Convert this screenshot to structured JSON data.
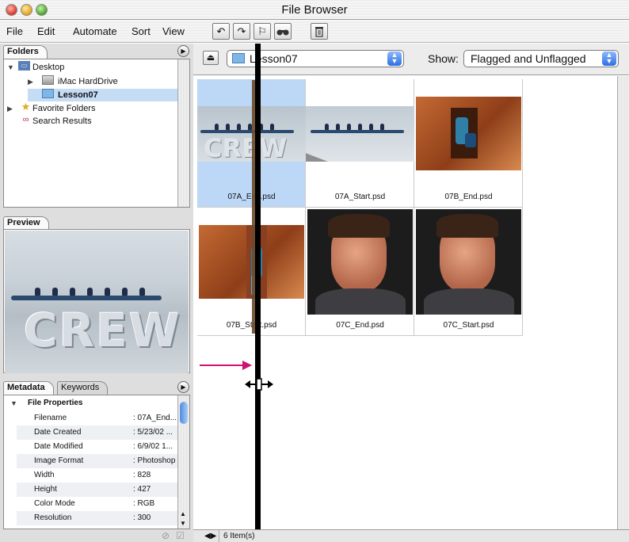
{
  "window": {
    "title": "File Browser"
  },
  "menu": {
    "items": [
      "File",
      "Edit",
      "Automate",
      "Sort",
      "View"
    ]
  },
  "toolbar": {
    "rotate_left_icon": "rotate-left-icon",
    "rotate_right_icon": "rotate-right-icon",
    "flag_icon": "flag-icon",
    "search_icon": "binoculars-icon",
    "trash_icon": "trash-icon"
  },
  "folders": {
    "tab_label": "Folders",
    "tree": [
      {
        "label": "Desktop"
      },
      {
        "label": "iMac HardDrive"
      },
      {
        "label": "Lesson07"
      },
      {
        "label": "Favorite Folders"
      },
      {
        "label": "Search Results"
      }
    ]
  },
  "preview": {
    "tab_label": "Preview",
    "image_text": "CREW"
  },
  "metadata": {
    "tab_label": "Metadata",
    "keywords_tab_label": "Keywords",
    "section_title": "File Properties",
    "rows": [
      {
        "key": "Filename",
        "value": ": 07A_End..."
      },
      {
        "key": "Date Created",
        "value": ": 5/23/02 ..."
      },
      {
        "key": "Date Modified",
        "value": ": 6/9/02 1..."
      },
      {
        "key": "Image Format",
        "value": ": Photoshop"
      },
      {
        "key": "Width",
        "value": ": 828"
      },
      {
        "key": "Height",
        "value": ": 427"
      },
      {
        "key": "Color Mode",
        "value": ": RGB"
      },
      {
        "key": "Resolution",
        "value": ": 300"
      }
    ]
  },
  "location": {
    "folder": "Lesson07"
  },
  "show": {
    "label": "Show:",
    "value": "Flagged and Unflagged"
  },
  "thumbnails": [
    {
      "name": "07A_End.psd",
      "selected": true,
      "overlay": "CREW"
    },
    {
      "name": "07A_Start.psd",
      "selected": false
    },
    {
      "name": "07B_End.psd",
      "selected": false
    },
    {
      "name": "07B_Start.psd",
      "selected": false
    },
    {
      "name": "07C_End.psd",
      "selected": false
    },
    {
      "name": "07C_Start.psd",
      "selected": false
    }
  ],
  "status": {
    "items_count": "6 Item(s)"
  },
  "colors": {
    "selection": "#bcd8f6",
    "arrow": "#cc1177",
    "divider": "#000000"
  }
}
